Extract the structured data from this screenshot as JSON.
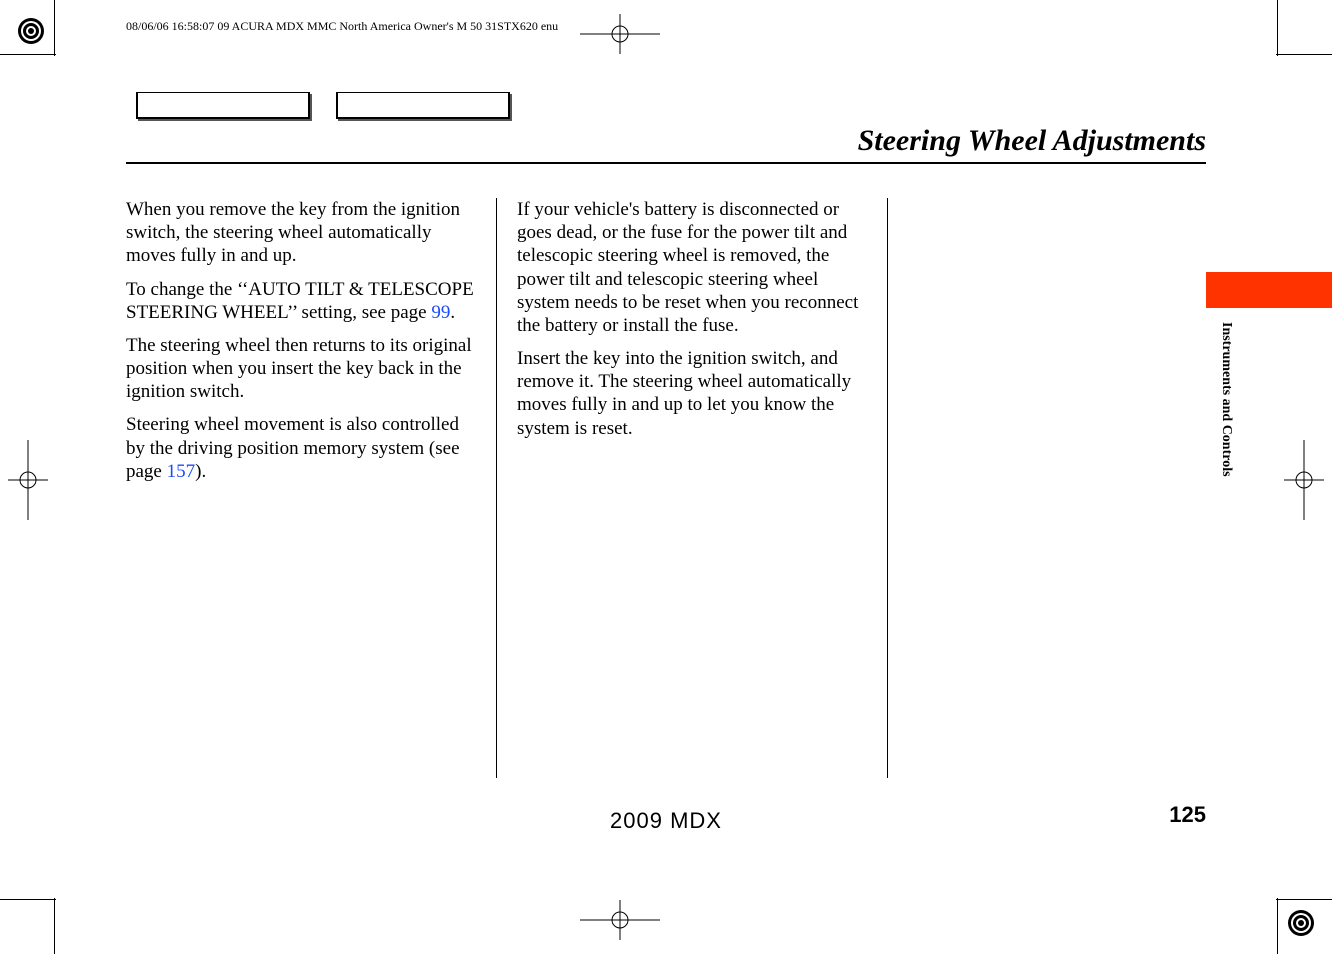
{
  "header_line": "08/06/06 16:58:07    09 ACURA MDX MMC North America Owner's M 50 31STX620 enu",
  "page_title": "Steering Wheel Adjustments",
  "side_tab": "Instruments and Controls",
  "footer_model": "2009  MDX",
  "page_number": "125",
  "col1": {
    "p1": "When you remove the key from the ignition switch, the steering wheel automatically moves fully in and up.",
    "p2a": "To change the ‘‘AUTO TILT & TELESCOPE STEERING WHEEL’’ setting, see page ",
    "p2b_link": "99",
    "p2c": ".",
    "p3": "The steering wheel then returns to its original position when you insert the key back in the ignition switch.",
    "p4a": "Steering wheel movement is also controlled by the driving position memory system (see page ",
    "p4b_link": "157",
    "p4c": ")."
  },
  "col2": {
    "p1": "If your vehicle's battery is disconnected or goes dead, or the fuse for the power tilt and telescopic steering wheel is removed, the power tilt and telescopic steering wheel system needs to be reset when you reconnect the battery or install the fuse.",
    "p2": "Insert the key into the ignition switch, and remove it. The steering wheel automatically moves fully in and up to let you know the system is reset."
  }
}
